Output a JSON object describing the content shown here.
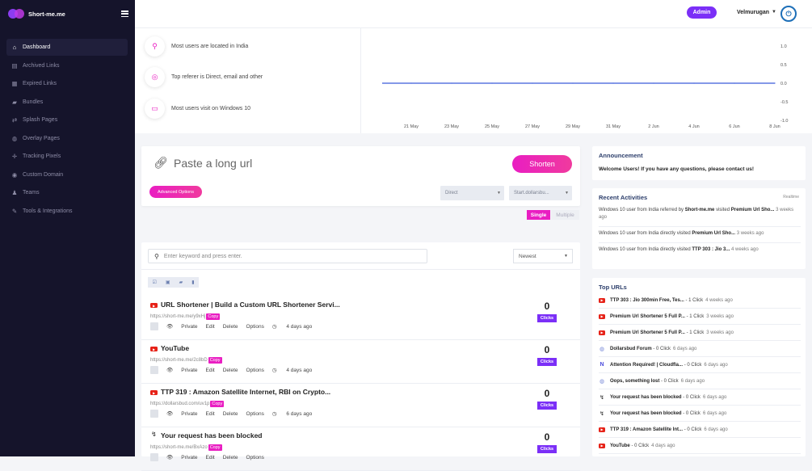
{
  "brand": {
    "name": "Short-me.me"
  },
  "nav": [
    {
      "label": "Dashboard",
      "icon": "home-icon",
      "glyph": "⌂",
      "active": true
    },
    {
      "label": "Archived Links",
      "icon": "archive-icon",
      "glyph": "▤",
      "active": false
    },
    {
      "label": "Expired Links",
      "icon": "calendar-icon",
      "glyph": "▦",
      "active": false
    },
    {
      "label": "Bundles",
      "icon": "folder-icon",
      "glyph": "▰",
      "active": false
    },
    {
      "label": "Splash Pages",
      "icon": "arrows-icon",
      "glyph": "⇄",
      "active": false
    },
    {
      "label": "Overlay Pages",
      "icon": "globe-icon",
      "glyph": "◍",
      "active": false
    },
    {
      "label": "Tracking Pixels",
      "icon": "crosshair-icon",
      "glyph": "✛",
      "active": false
    },
    {
      "label": "Custom Domain",
      "icon": "globe-icon",
      "glyph": "◉",
      "active": false
    },
    {
      "label": "Teams",
      "icon": "user-icon",
      "glyph": "♟",
      "active": false
    },
    {
      "label": "Tools & Integrations",
      "icon": "wrench-icon",
      "glyph": "✎",
      "active": false
    }
  ],
  "topbar": {
    "admin_label": "Admin",
    "username": "Velmurugan"
  },
  "stats": [
    {
      "text": "Most users are located in India",
      "icon": "location-pin-icon",
      "glyph": "⚲",
      "color": "#e91ec2"
    },
    {
      "text": "Top referer is Direct, email and other",
      "icon": "globe-icon",
      "glyph": "◎",
      "color": "#e91ec2"
    },
    {
      "text": "Most users visit on Windows 10",
      "icon": "monitor-icon",
      "glyph": "▭",
      "color": "#e91ec2"
    }
  ],
  "chart_data": {
    "type": "line",
    "x": [
      "21 May",
      "23 May",
      "25 May",
      "27 May",
      "29 May",
      "31 May",
      "2 Jun",
      "4 Jun",
      "6 Jun",
      "8 Jun"
    ],
    "series": [
      {
        "values": [
          0,
          0,
          0,
          0,
          0,
          0,
          0,
          0,
          0,
          0
        ]
      }
    ],
    "y_ticks": [
      "1.0",
      "0.5",
      "0.0",
      "-0.5",
      "-1.0"
    ],
    "ylim": [
      -1.0,
      1.0
    ],
    "line_color": "#3b5bdb",
    "grid": false
  },
  "shortener": {
    "placeholder": "Paste a long url",
    "shorten_label": "Shorten",
    "advanced_label": "Advanced Options",
    "select1": "Direct",
    "select2": "Start.dollarsbu...",
    "mode_single": "Single",
    "mode_multiple": "Multiple"
  },
  "links": {
    "search_placeholder": "Enter keyword and press enter.",
    "sort": "Newest",
    "copy_label": "Copy",
    "clicks_label": "Clicks",
    "private_label": "Private",
    "edit_label": "Edit",
    "delete_label": "Delete",
    "options_label": "Options",
    "rows": [
      {
        "title": "URL Shortener | Build a Custom URL Shortener Servi...",
        "url": "https://short-me.me/y9xHj",
        "time": "4 days ago",
        "clicks": "0",
        "icon": "youtube-icon",
        "glyph": "▶"
      },
      {
        "title": "YouTube",
        "url": "https://short-me.me/2c8bD",
        "time": "4 days ago",
        "clicks": "0",
        "icon": "youtube-icon",
        "glyph": "▶"
      },
      {
        "title": "TTP 319 : Amazon Satellite Internet, RBI on Crypto...",
        "url": "https://dollarsbud.com/uv1p",
        "time": "6 days ago",
        "clicks": "0",
        "icon": "youtube-icon",
        "glyph": "▶"
      },
      {
        "title": "Your request has been blocked",
        "url": "https://short-me.me/BxAzo",
        "time": "",
        "clicks": "0",
        "icon": "blocked-site-icon",
        "glyph": "↯"
      }
    ]
  },
  "announcement": {
    "title": "Announcement",
    "body": "Welcome Users! If you have any questions, please contact us!"
  },
  "activities": {
    "title": "Recent Activities",
    "realtime": "Realtime",
    "items": [
      {
        "pre": "Windows 10 user from India referred by ",
        "b1": "Short-me.me",
        "mid": " visited ",
        "b2": "Premium Url Sho...",
        "ago": "3 weeks ago"
      },
      {
        "pre": "Windows 10 user from India directly visited ",
        "b1": "Premium Url Sho...",
        "mid": "",
        "b2": "",
        "ago": "3 weeks ago"
      },
      {
        "pre": "Windows 10 user from India directly visited ",
        "b1": "TTP 303 : Jio 3...",
        "mid": "",
        "b2": "",
        "ago": "4 weeks ago"
      }
    ]
  },
  "top_urls": {
    "title": "Top URLs",
    "items": [
      {
        "name": "TTP 303 : Jio 300min Free, Tes...",
        "clicks": "- 1 Click",
        "ago": "4 weeks ago",
        "icon": "youtube-icon",
        "kind": "yt",
        "glyph": "▶"
      },
      {
        "name": "Premium Url Shortener 5 Full P...",
        "clicks": "- 1 Click",
        "ago": "3 weeks ago",
        "icon": "youtube-icon",
        "kind": "yt",
        "glyph": "▶"
      },
      {
        "name": "Premium Url Shortener 5 Full P...",
        "clicks": "- 1 Click",
        "ago": "3 weeks ago",
        "icon": "youtube-icon",
        "kind": "yt",
        "glyph": "▶"
      },
      {
        "name": "Dollarsbud Forum",
        "clicks": "- 0 Click",
        "ago": "6 days ago",
        "icon": "globe-icon",
        "kind": "gl",
        "glyph": "◍"
      },
      {
        "name": "Attention Required! | Cloudfla...",
        "clicks": "- 0 Click",
        "ago": "6 days ago",
        "icon": "cloudflare-icon",
        "kind": "cf",
        "glyph": "N"
      },
      {
        "name": "Oops, something lost",
        "clicks": "- 0 Click",
        "ago": "6 days ago",
        "icon": "globe-icon",
        "kind": "gl",
        "glyph": "◍"
      },
      {
        "name": "Your request has been blocked",
        "clicks": "- 0 Click",
        "ago": "6 days ago",
        "icon": "blocked-site-icon",
        "kind": "bk",
        "glyph": "↯"
      },
      {
        "name": "Your request has been blocked",
        "clicks": "- 0 Click",
        "ago": "6 days ago",
        "icon": "blocked-site-icon",
        "kind": "bk",
        "glyph": "↯"
      },
      {
        "name": "TTP 319 : Amazon Satellite Int...",
        "clicks": "- 0 Click",
        "ago": "6 days ago",
        "icon": "youtube-icon",
        "kind": "yt",
        "glyph": "▶"
      },
      {
        "name": "YouTube",
        "clicks": "- 0 Click",
        "ago": "4 days ago",
        "icon": "youtube-icon",
        "kind": "yt",
        "glyph": "▶"
      }
    ]
  }
}
